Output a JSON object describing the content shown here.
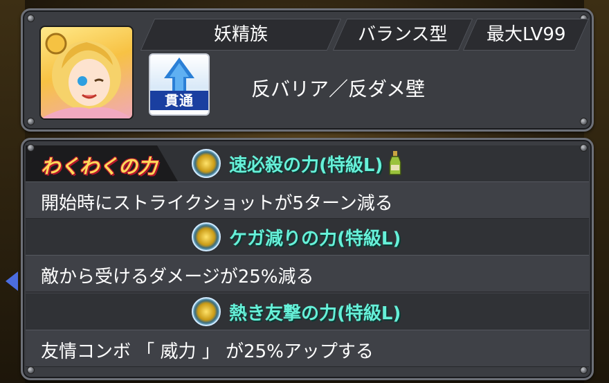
{
  "header": {
    "race": "妖精族",
    "battle_type": "バランス型",
    "max_level": "最大LV99",
    "gimmick": "貫通",
    "ability": "反バリア／反ダメ壁"
  },
  "wakuwaku": {
    "tab_label": "わくわくの力",
    "powers": [
      {
        "name": "速必殺の力(特級L)",
        "description": "開始時にストライクショットが5ターン減る",
        "icon": "power-orb-icon",
        "has_item_icon": true
      },
      {
        "name": "ケガ減りの力(特級L)",
        "description": "敵から受けるダメージが25%減る",
        "icon": "power-orb-icon",
        "has_item_icon": false
      },
      {
        "name": "熱き友撃の力(特級L)",
        "description": "友情コンボ 「 威力 」 が25%アップする",
        "icon": "power-orb-icon",
        "has_item_icon": false
      }
    ]
  },
  "colors": {
    "power_text": "#66f0d8",
    "panel_bg": "#3b3d42",
    "gimmick_blue": "#1a3fa0",
    "waku_yellow": "#ffd95a"
  }
}
